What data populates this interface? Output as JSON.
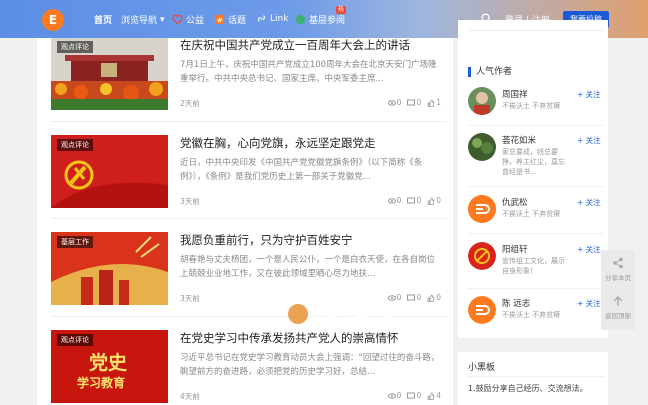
{
  "nav": {
    "logo": "E",
    "items": [
      {
        "label": "首页"
      },
      {
        "label": "浏览导航",
        "caret": "▾"
      },
      {
        "label": "公益"
      },
      {
        "label": "话题"
      },
      {
        "label": "Link"
      },
      {
        "label": "基层参阅"
      }
    ],
    "hot_badge": "热",
    "login": "登录",
    "sep": "|",
    "register": "注册",
    "submit": "我要投稿"
  },
  "articles": [
    {
      "tag": "观点评论",
      "title": "在庆祝中国共产党成立一百周年大会上的讲话",
      "desc": "7月1日上午，庆祝中国共产党成立100周年大会在北京天安门广场隆重举行。中共中央总书记、国家主席、中央军委主席...",
      "time": "2天前",
      "views": "0",
      "comments": "0",
      "likes": "1"
    },
    {
      "tag": "观点评论",
      "title": "党徽在胸，心向党旗，永远坚定跟党走",
      "desc": "近日，中共中央印发《中国共产党党徽党旗条例》（以下简称《条例》），《条例》是我们党历史上第一部关于党徽党...",
      "time": "3天前",
      "views": "0",
      "comments": "0",
      "likes": "0"
    },
    {
      "tag": "基层工作",
      "title": "我愿负重前行，只为守护百姓安宁",
      "desc": "胡春艳与丈夫杨团，一个是人民公仆，一个是白衣天使，在各自岗位上兢兢业业地工作，又在彼此领域里晒心尽力地扶...",
      "time": "3天前",
      "views": "0",
      "comments": "0",
      "likes": "0"
    },
    {
      "tag": "观点评论",
      "title": "在党史学习中传承发扬共产党人的崇高情怀",
      "desc": "习近平总书记在党史学习教育动员大会上强调：“回望过往的奋斗路，眺望前方的奋进路，必须把党的历史学习好，总结...",
      "time": "4天前",
      "views": "0",
      "comments": "0",
      "likes": "4",
      "thumb_text1": "党史",
      "thumb_text2": "学习教育"
    }
  ],
  "sidebar": {
    "authors_title": "人气作者",
    "authors": [
      {
        "name": "周国祥",
        "desc": "不挨沃土 不弃贫瘠",
        "follow": "+ 关注"
      },
      {
        "name": "荟花如米",
        "desc": "家总要成，钱总要挣，养主红尘，莫忘曾经是书...",
        "follow": "+ 关注"
      },
      {
        "name": "仇武松",
        "desc": "不挨沃土 不弃贫瘠",
        "follow": "+ 关注"
      },
      {
        "name": "阳组轩",
        "desc": "宣传组工文化，展示自身形象！",
        "follow": "+ 关注"
      },
      {
        "name": "陈 远志",
        "desc": "不挨沃土 不弃贫瘠",
        "follow": "+ 关注"
      }
    ],
    "board_title": "小黑板",
    "board_item": "1.鼓励分享自己经历、交流想法。"
  },
  "float": {
    "share": "分享本页",
    "top": "返回顶部"
  },
  "watermark": {
    "main": "搜索引擎大全",
    "sub": "ZHOUBLOG.CN"
  }
}
